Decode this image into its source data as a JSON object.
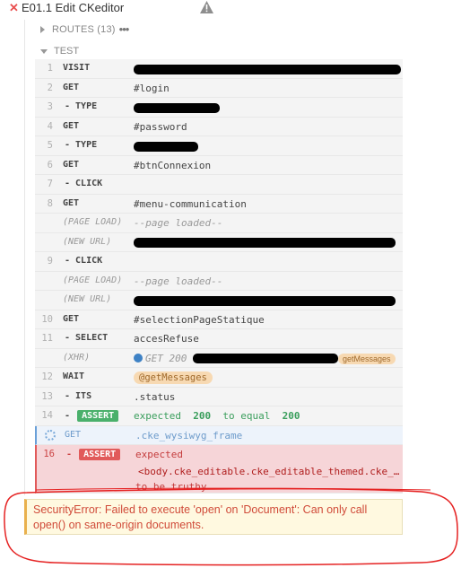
{
  "test": {
    "status_icon": "fail-x-icon",
    "title": "E01.1 Edit CKeditor",
    "warning_icon": "warning-triangle-icon"
  },
  "routes": {
    "label": "ROUTES (13)",
    "menu_icon": "dots-icon",
    "menu_glyph": "•••"
  },
  "section": {
    "label": "TEST"
  },
  "commands": {
    "c1": {
      "num": "1",
      "name": "VISIT"
    },
    "c2": {
      "num": "2",
      "name": "GET",
      "msg": "#login"
    },
    "c3": {
      "num": "3",
      "name": "- TYPE"
    },
    "c4": {
      "num": "4",
      "name": "GET",
      "msg": "#password"
    },
    "c5": {
      "num": "5",
      "name": "- TYPE"
    },
    "c6": {
      "num": "6",
      "name": "GET",
      "msg": "#btnConnexion"
    },
    "c7": {
      "num": "7",
      "name": "- CLICK"
    },
    "c8": {
      "num": "8",
      "name": "GET",
      "msg": "#menu-communication"
    },
    "e1": {
      "name": "(PAGE LOAD)",
      "msg": "--page loaded--"
    },
    "e2": {
      "name": "(NEW URL)"
    },
    "c9": {
      "num": "9",
      "name": "- CLICK"
    },
    "e3": {
      "name": "(PAGE LOAD)",
      "msg": "--page loaded--"
    },
    "e4": {
      "name": "(NEW URL)"
    },
    "c10": {
      "num": "10",
      "name": "GET",
      "msg": "#selectionPageStatique"
    },
    "c11": {
      "num": "11",
      "name": "- SELECT",
      "msg": "accesRefuse"
    },
    "e5": {
      "name": "(XHR)",
      "msg": "GET 200",
      "alias": "getMessages"
    },
    "c12": {
      "num": "12",
      "name": "WAIT",
      "alias": "@getMessages"
    },
    "c13": {
      "num": "13",
      "name": "- ITS",
      "msg": ".status"
    },
    "c14": {
      "num": "14",
      "name": "-",
      "badge": "ASSERT",
      "w1": "expected",
      "v1": "200",
      "w2": "to equal",
      "v2": "200"
    },
    "c15": {
      "name": "GET",
      "msg": ".cke_wysiwyg_frame"
    },
    "c16": {
      "num": "16",
      "name": "-",
      "badge": "ASSERT",
      "msg": "expected",
      "line2": "<body.cke_editable.cke_editable_themed.cke_contents_ltr>",
      "line3": "to be truthy"
    }
  },
  "error": {
    "message": "SecurityError: Failed to execute 'open' on 'Document': Can only call open() on same-origin documents."
  },
  "colors": {
    "fail": "#e15a5a",
    "pass": "#4ab06b",
    "pending": "#6aa0d8",
    "alias_bg": "#f7d9b2",
    "error_text": "#d04b39"
  }
}
